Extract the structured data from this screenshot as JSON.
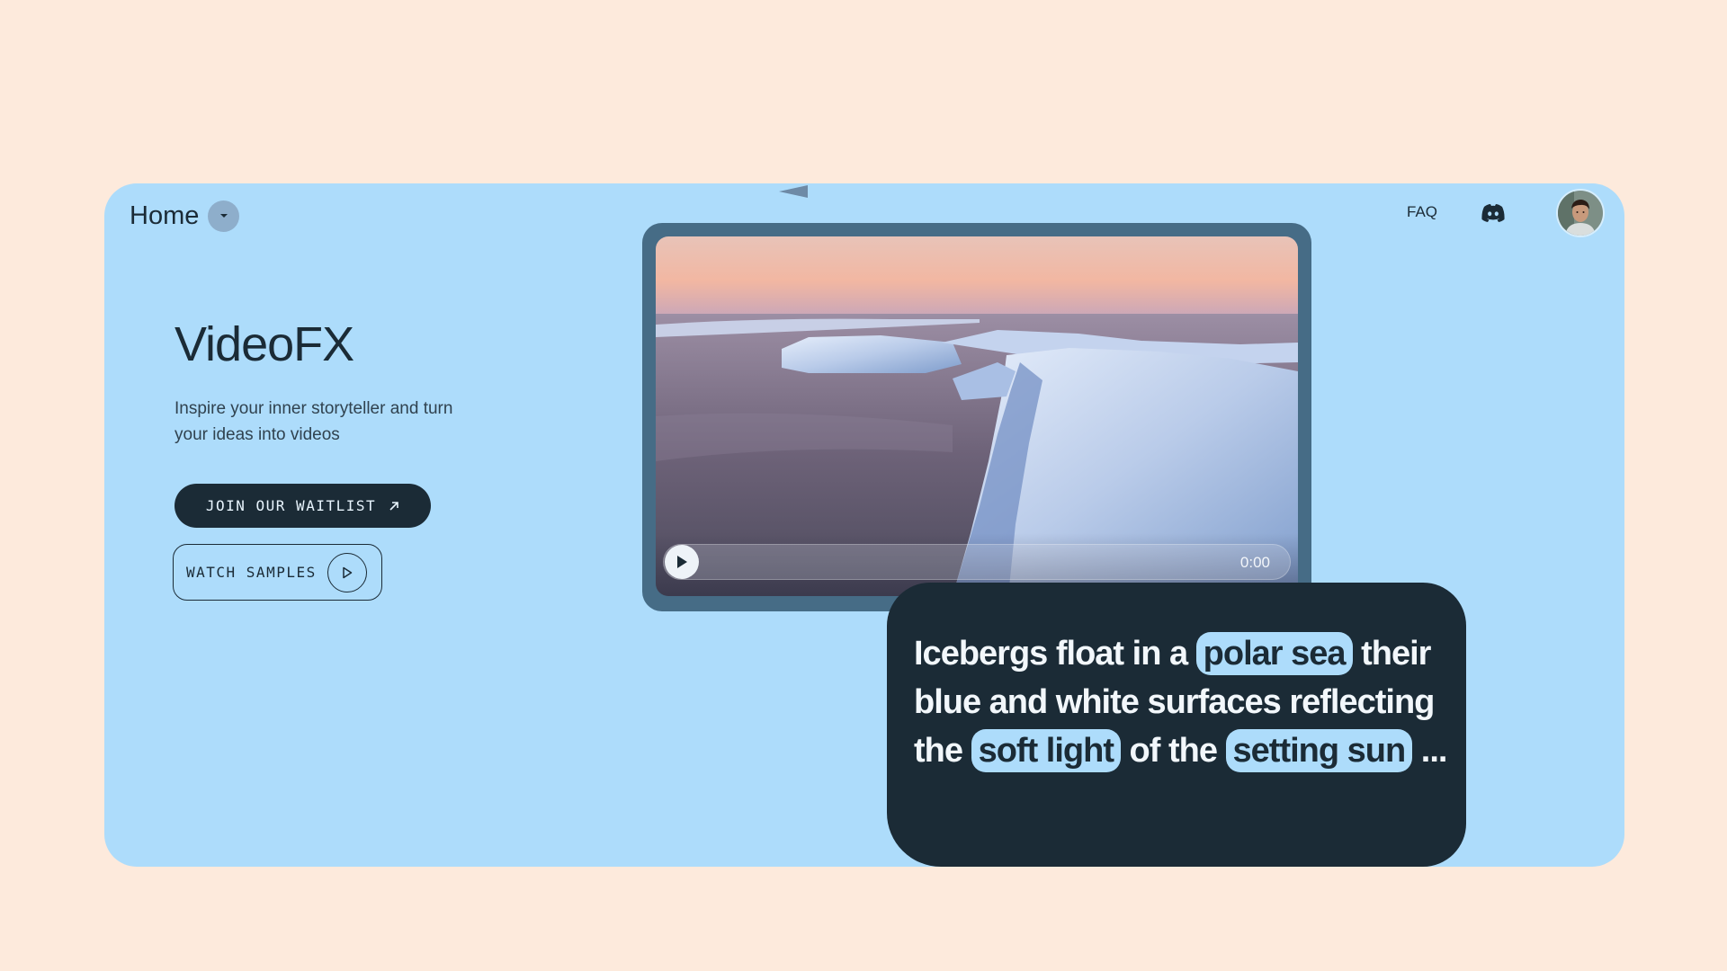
{
  "nav": {
    "home_label": "Home",
    "faq_label": "FAQ",
    "discord_icon": "discord-icon",
    "avatar_icon": "user-avatar"
  },
  "hero": {
    "title": "VideoFX",
    "subtitle": "Inspire your inner storyteller and turn your ideas into videos",
    "waitlist_label": "JOIN OUR WAITLIST",
    "watch_label": "WATCH SAMPLES"
  },
  "player": {
    "time": "0:00",
    "progress": 0
  },
  "prompt": {
    "p1": "Icebergs float in a",
    "chip1": "polar sea",
    "p2": "their blue and white surfaces reflecting the",
    "chip2": "soft light",
    "p3": "of the",
    "chip3": "setting sun",
    "p4": "..."
  },
  "colors": {
    "page_bg": "#fdeadc",
    "card_bg": "#addcfb",
    "dark": "#1b2b36",
    "frame": "#466c86"
  }
}
